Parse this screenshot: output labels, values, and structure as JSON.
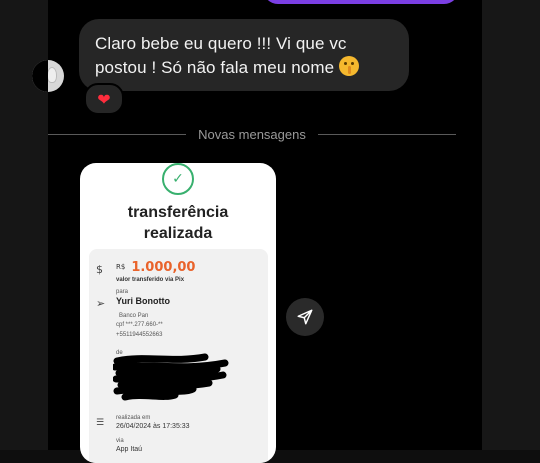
{
  "message": {
    "text": "Claro bebe eu quero !!! Vi que vc postou ! Só não fala meu nome",
    "reaction": "❤"
  },
  "divider": {
    "label": "Novas mensagens"
  },
  "receipt": {
    "title": "transferência realizada",
    "currency": "R$",
    "amount": "1.000,00",
    "amount_caption": "valor transferido via Pix",
    "to_label": "para",
    "recipient_name": "Yuri Bonotto",
    "bank": "Banco Pan",
    "cpf": "cpf ***.277.660-**",
    "phone": "+5511944552663",
    "from_label": "de",
    "date_label": "realizada em",
    "date_value": "26/04/2024 às 17:35:33",
    "via_label": "via",
    "via_value": "App Itaú"
  },
  "icons": {
    "check": "check-circle-icon",
    "money": "money-icon",
    "send": "send-icon",
    "list": "list-icon"
  },
  "colors": {
    "accent": "#7b3fe4",
    "amount": "#e9632b",
    "check": "#38b06e"
  }
}
